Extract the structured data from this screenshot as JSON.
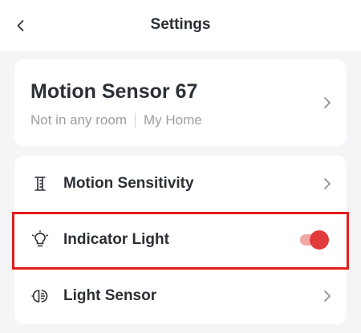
{
  "header": {
    "title": "Settings"
  },
  "device": {
    "name": "Motion Sensor 67",
    "room": "Not in any room",
    "home": "My Home"
  },
  "settings": {
    "items": [
      {
        "label": "Motion Sensitivity",
        "icon": "ruler-icon",
        "control": "chevron"
      },
      {
        "label": "Indicator Light",
        "icon": "lightbulb-icon",
        "control": "toggle",
        "toggle_on": true
      },
      {
        "label": "Light Sensor",
        "icon": "light-sensor-icon",
        "control": "chevron"
      }
    ]
  },
  "colors": {
    "toggle_on": "#e23b3b",
    "highlight": "#e11d1d",
    "background": "#f5f5f7"
  }
}
